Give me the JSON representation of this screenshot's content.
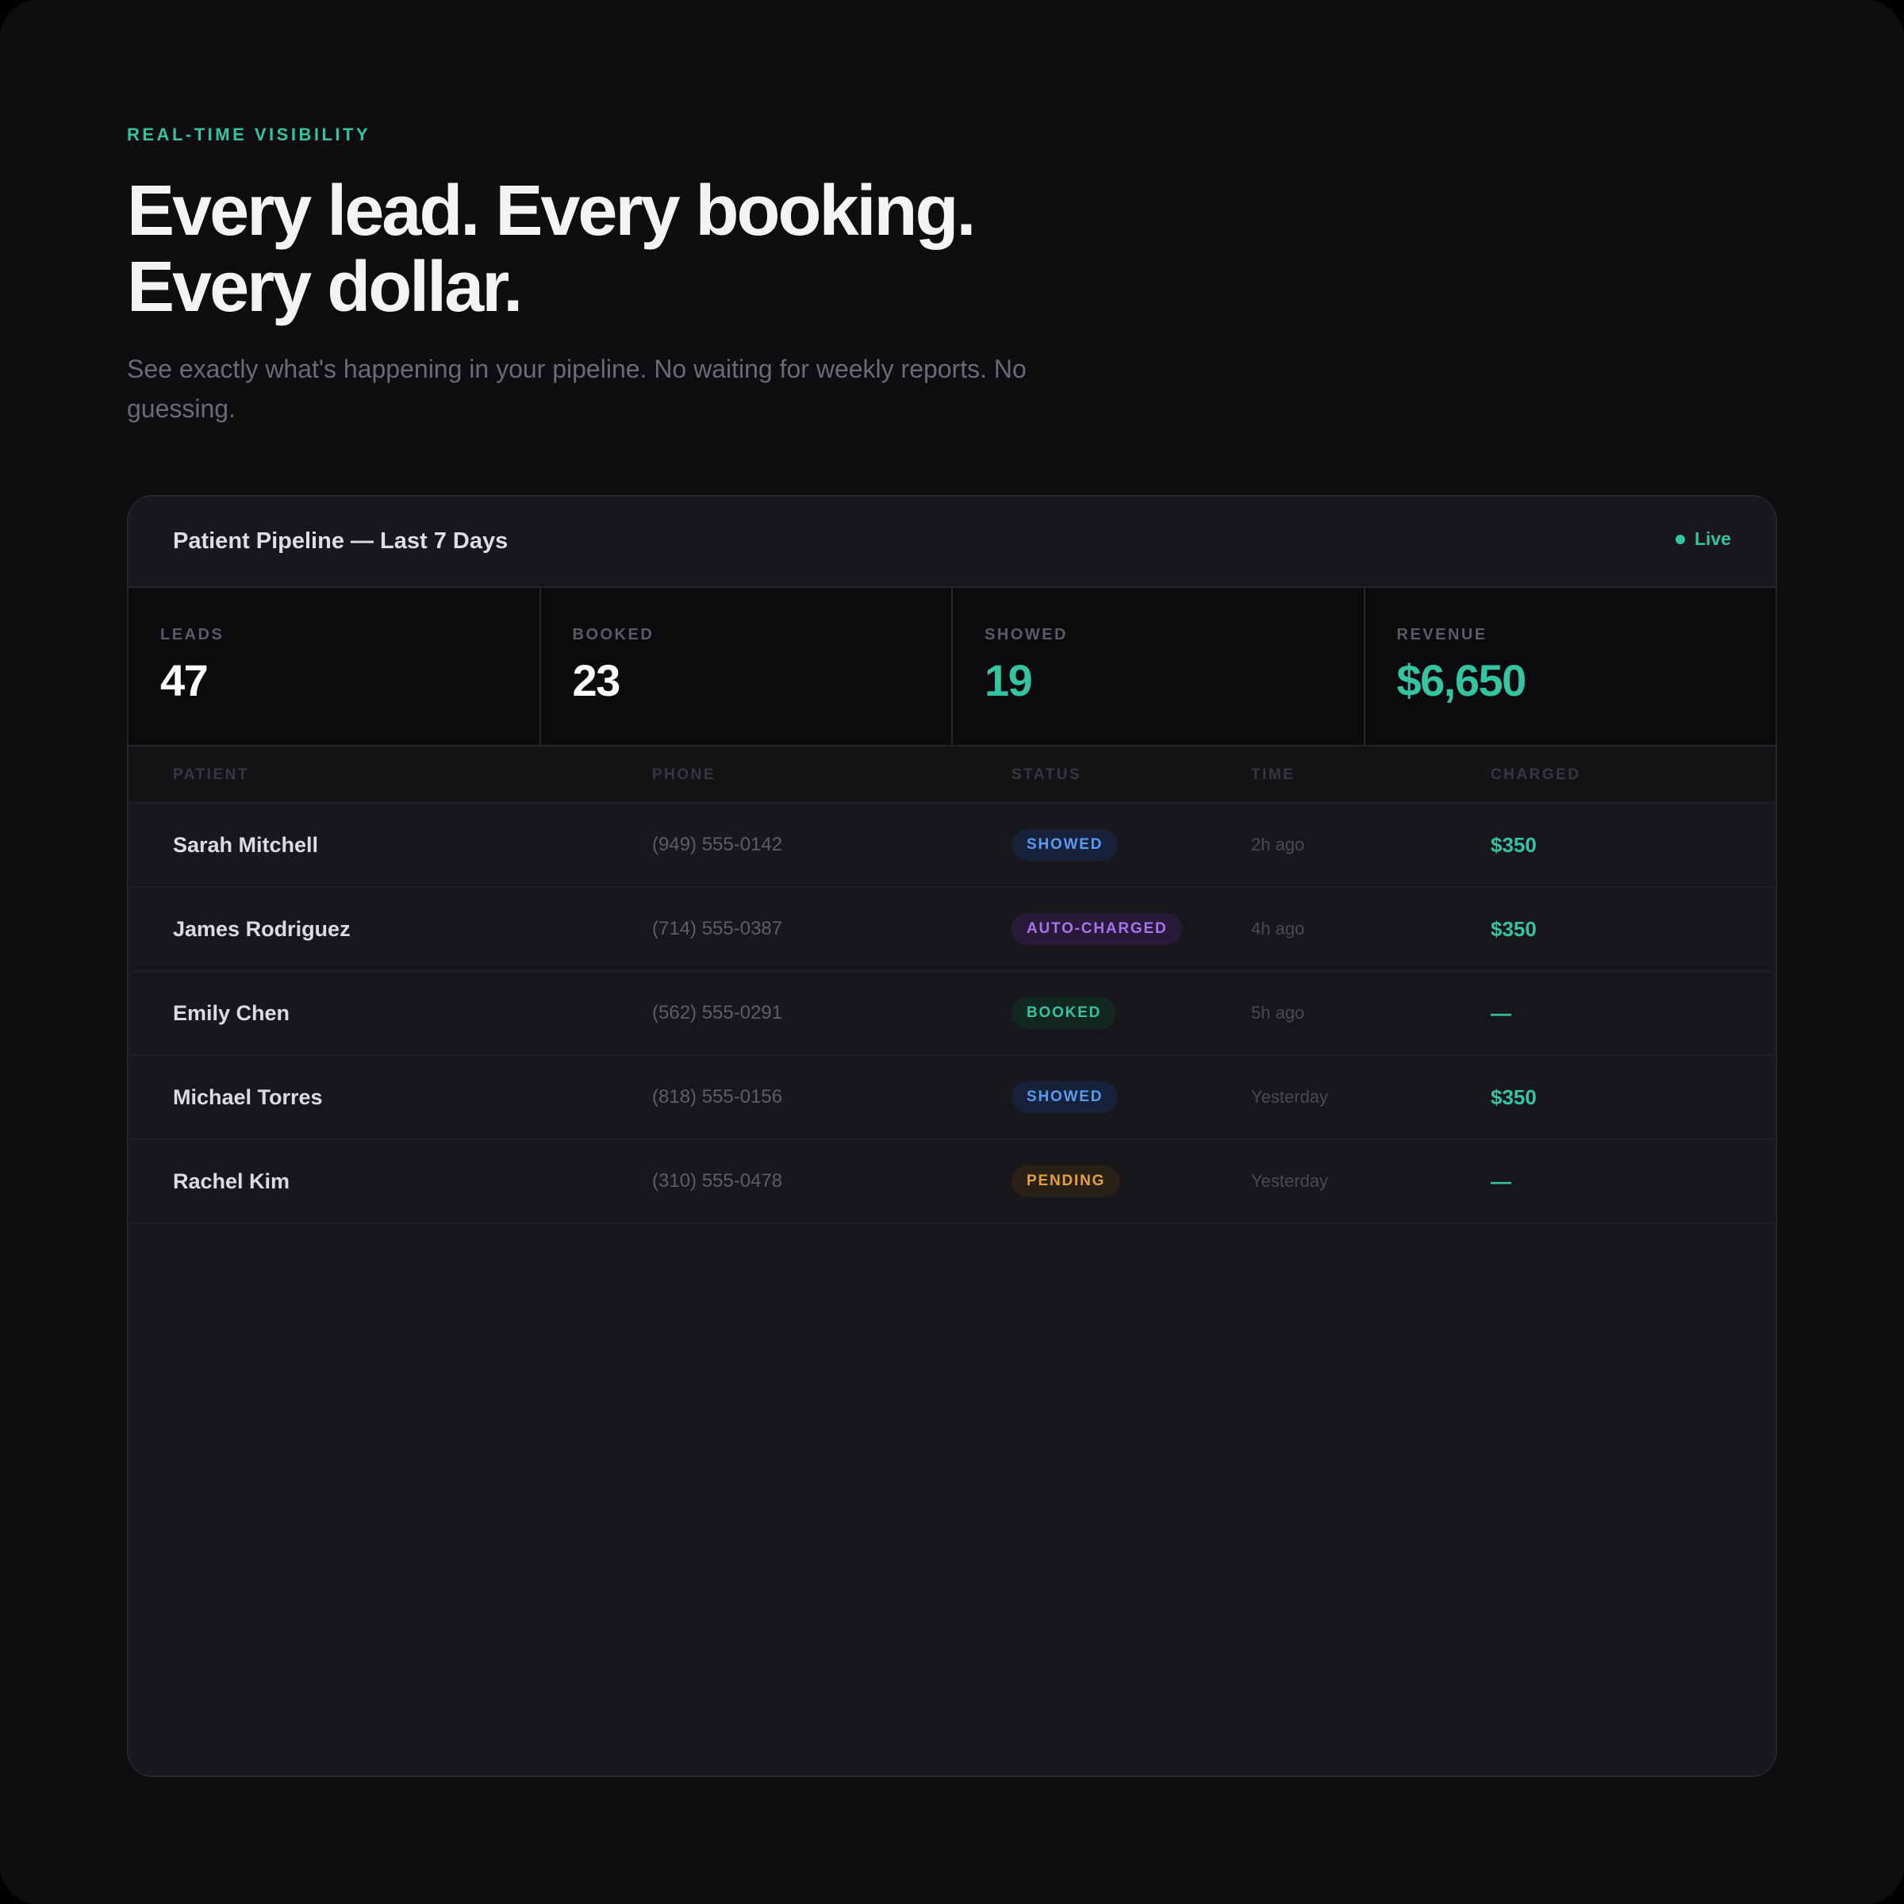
{
  "hero": {
    "eyebrow": "REAL-TIME VISIBILITY",
    "headline_line1": "Every lead. Every booking.",
    "headline_line2": "Every dollar.",
    "subtitle": "See exactly what's happening in your pipeline. No waiting for weekly reports. No guessing."
  },
  "card": {
    "title": "Patient Pipeline — Last 7 Days",
    "live_label": "Live",
    "live_color": "#34c4a2"
  },
  "stats": [
    {
      "label": "LEADS",
      "value": "47"
    },
    {
      "label": "BOOKED",
      "value": "23"
    },
    {
      "label": "SHOWED",
      "value": "19"
    },
    {
      "label": "REVENUE",
      "value": "$6,650"
    }
  ],
  "table": {
    "columns": [
      "PATIENT",
      "PHONE",
      "STATUS",
      "TIME",
      "CHARGED"
    ],
    "rows": [
      {
        "patient": "Sarah Mitchell",
        "phone": "(949) 555-0142",
        "status": "SHOWED",
        "time": "2h ago",
        "charged": "$350"
      },
      {
        "patient": "James Rodriguez",
        "phone": "(714) 555-0387",
        "status": "AUTO-CHARGED",
        "time": "4h ago",
        "charged": "$350"
      },
      {
        "patient": "Emily Chen",
        "phone": "(562) 555-0291",
        "status": "BOOKED",
        "time": "5h ago",
        "charged": "—"
      },
      {
        "patient": "Michael Torres",
        "phone": "(818) 555-0156",
        "status": "SHOWED",
        "time": "Yesterday",
        "charged": "$350"
      },
      {
        "patient": "Rachel Kim",
        "phone": "(310) 555-0478",
        "status": "PENDING",
        "time": "Yesterday",
        "charged": "—"
      }
    ]
  },
  "colors": {
    "accent": "#34c4a2",
    "showed": "#5b9bf3",
    "auto_charged": "#a972ef",
    "booked": "#34c4a2",
    "pending": "#e3a13f",
    "background": "#0e0d10",
    "card": "#18171b"
  }
}
